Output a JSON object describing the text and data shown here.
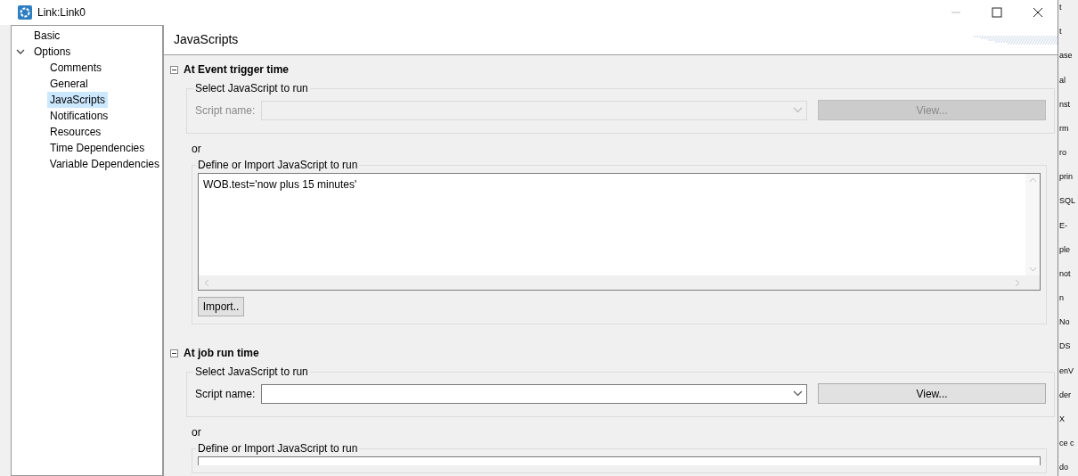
{
  "window": {
    "title": "Link:Link0"
  },
  "sidebar": {
    "items": [
      {
        "label": "Basic",
        "selected": false
      },
      {
        "label": "Options",
        "selected": false,
        "expanded": true,
        "children": [
          {
            "label": "Comments",
            "selected": false
          },
          {
            "label": "General",
            "selected": false
          },
          {
            "label": "JavaScripts",
            "selected": true
          },
          {
            "label": "Notifications",
            "selected": false
          },
          {
            "label": "Resources",
            "selected": false
          },
          {
            "label": "Time Dependencies",
            "selected": false
          },
          {
            "label": "Variable Dependencies",
            "selected": false
          }
        ]
      }
    ]
  },
  "panel": {
    "title": "JavaScripts"
  },
  "sections": [
    {
      "title": "At Event trigger time",
      "expanded": true,
      "select_group": {
        "legend": "Select JavaScript to run",
        "label": "Script name:",
        "disabled": true,
        "button": "View..."
      },
      "or_text": "or",
      "define_group": {
        "legend": "Define or Import JavaScript to run",
        "code": "WOB.test='now plus 15 minutes'",
        "button": "Import.."
      }
    },
    {
      "title": "At job run time",
      "expanded": true,
      "select_group": {
        "legend": "Select JavaScript to run",
        "label": "Script name:",
        "disabled": false,
        "button": "View..."
      },
      "or_text": "or",
      "define_group": {
        "legend": "Define or Import JavaScript to run"
      }
    }
  ],
  "background_window": {
    "items": [
      "t",
      "t",
      "ase",
      "al",
      "nst",
      "rm",
      "ro",
      "prin",
      "SQL",
      "E-",
      "ple",
      "not",
      "n",
      "No",
      "DS",
      "enV",
      "der",
      "X",
      "ce c",
      "do"
    ]
  }
}
